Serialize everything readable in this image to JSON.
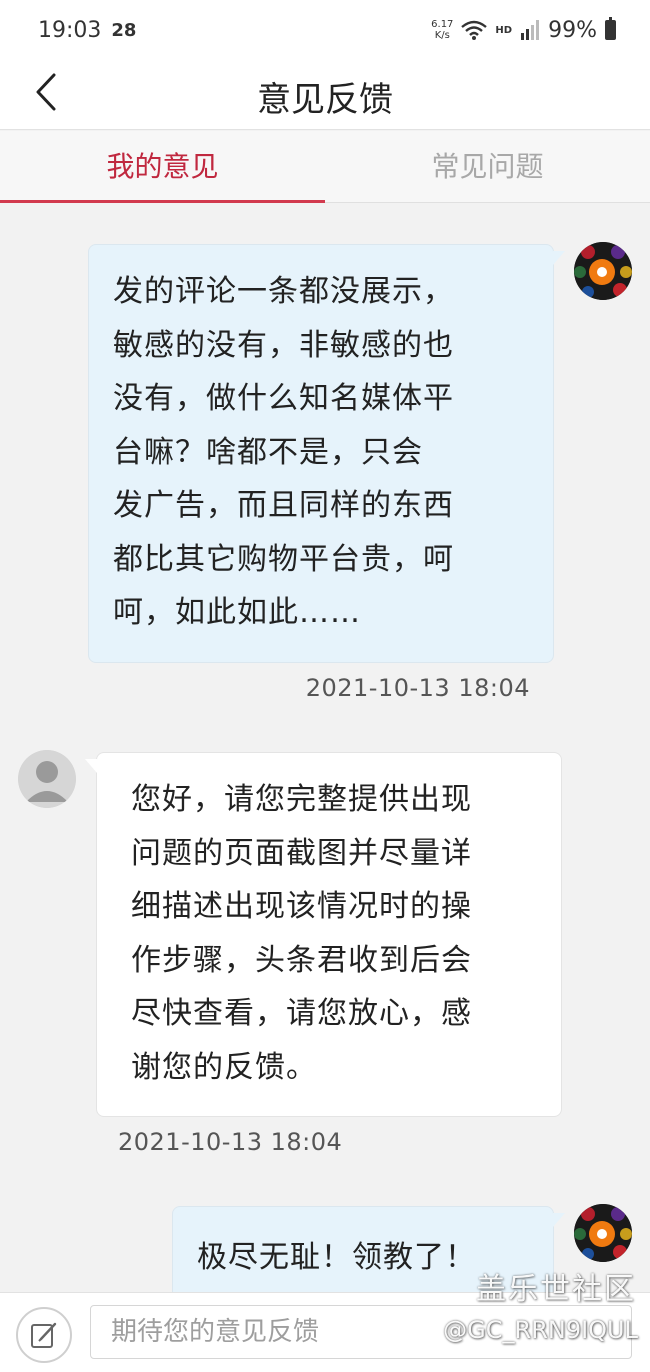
{
  "status_bar": {
    "time": "19:03",
    "notification": "28",
    "net_speed": "6.17",
    "net_speed_unit": "K/s",
    "hd_label": "HD",
    "battery": "99%",
    "icons": [
      "wifi-icon",
      "signal-icon",
      "battery-icon"
    ]
  },
  "header": {
    "back_icon": "chevron-left-icon",
    "title": "意见反馈"
  },
  "tabs": [
    {
      "label": "我的意见",
      "active": true
    },
    {
      "label": "常见问题",
      "active": false
    }
  ],
  "messages": [
    {
      "sender": "user",
      "lines": [
        "发的评论一条都没展示，",
        "敏感的没有，非敏感的也",
        "没有，做什么知名媒体平",
        "台嘛？啥都不是，只会",
        "发广告，而且同样的东西",
        "都比其它购物平台贵，呵",
        "呵，如此如此……"
      ],
      "timestamp": "2021-10-13 18:04"
    },
    {
      "sender": "support",
      "lines": [
        "您好，请您完整提供出现",
        "问题的页面截图并尽量详",
        "细描述出现该情况时的操",
        "作步骤，头条君收到后会",
        "尽快查看，请您放心，感",
        "谢您的反馈。"
      ],
      "timestamp": "2021-10-13 18:04"
    },
    {
      "sender": "user",
      "lines": [
        "极尽无耻！领教了！"
      ]
    }
  ],
  "input_bar": {
    "compose_icon": "compose-icon",
    "placeholder": "期待您的意见反馈"
  },
  "watermark": {
    "title": "盖乐世社区",
    "handle": "@GC_RRN9IQUL"
  },
  "colors": {
    "accent": "#c0283f",
    "user_bubble": "#e6f3fb",
    "support_bubble": "#ffffff",
    "background": "#f2f2f2"
  }
}
